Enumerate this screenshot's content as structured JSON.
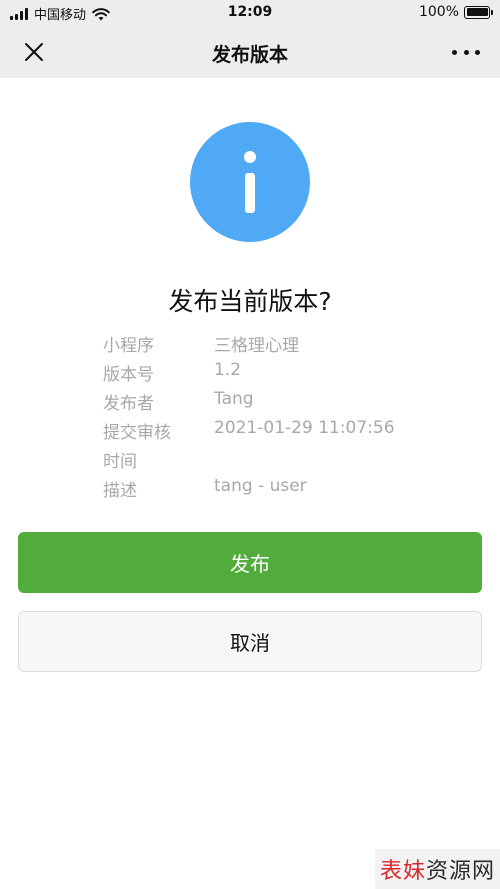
{
  "status_bar": {
    "carrier": "中国移动",
    "time": "12:09",
    "battery": "100%",
    "battery_level": 1.0
  },
  "nav": {
    "title": "发布版本",
    "close_icon": "close-icon",
    "more_icon": "more-dots-icon"
  },
  "dialog": {
    "icon": "info-icon",
    "icon_color": "#4fa9f4",
    "title": "发布当前版本?",
    "details": [
      {
        "label": "小程序",
        "value": "三格理心理"
      },
      {
        "label": "版本号",
        "value": "1.2"
      },
      {
        "label": "发布者",
        "value": "Tang"
      },
      {
        "label": "提交审核",
        "value": "2021-01-29 11:07:56"
      },
      {
        "label": "时间",
        "value": ""
      },
      {
        "label": "描述",
        "value": "tang - user"
      }
    ],
    "primary_button": "发布",
    "primary_color": "#52ac3c",
    "secondary_button": "取消"
  },
  "watermark": {
    "part1": "表妹",
    "part2": "资源网"
  }
}
